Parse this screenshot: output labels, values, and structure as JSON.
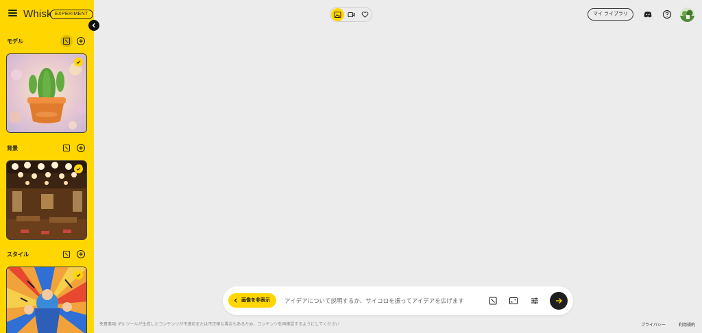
{
  "app": {
    "title": "Whisk",
    "badge": "EXPERIMENT"
  },
  "sidebar": {
    "sections": [
      {
        "title": "モデル",
        "selected": true,
        "image": "cactus in terracotta pot"
      },
      {
        "title": "背景",
        "selected": true,
        "image": "japanese restaurant interior with lanterns"
      },
      {
        "title": "スタイル",
        "selected": true,
        "image": "comic pop art style"
      }
    ]
  },
  "header": {
    "library_label": "マイ ライブラリ",
    "icons": [
      "image-generate-icon",
      "video-icon",
      "heart-icon",
      "discord-icon",
      "help-icon"
    ]
  },
  "prompt": {
    "hide_images_label": "画像を非表示",
    "placeholder": "アイデアについて説明するか、サイコロを振ってアイデアを広げます"
  },
  "footer": {
    "disclaimer": "免責事項: IFX ツールが生成したコンテンツが不適切または不正確な場合もあるため、コンテンツを再確認するようにしてください",
    "privacy": "プライバシー",
    "terms": "利用規約"
  },
  "colors": {
    "accent": "#ffd600",
    "background": "#ececec",
    "dark": "#1f1f1f"
  }
}
